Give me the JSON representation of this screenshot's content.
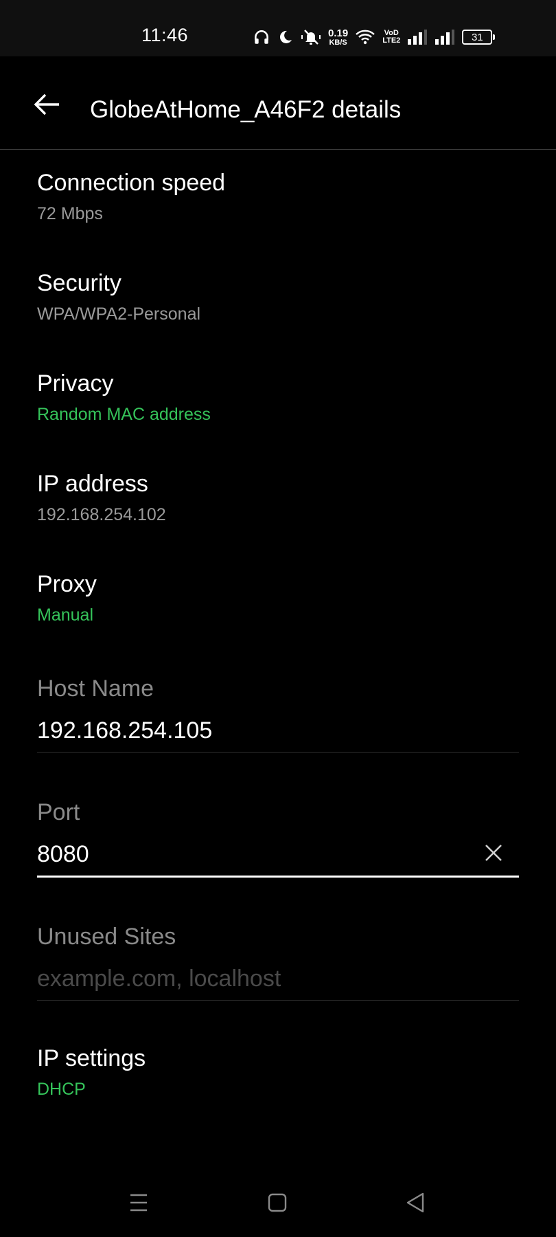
{
  "status_bar": {
    "time": "11:46",
    "net_speed_value": "0.19",
    "net_speed_unit": "KB/S",
    "volte_top": "VoD",
    "volte_bottom": "LTE2",
    "battery_level": "31"
  },
  "header": {
    "title": "GlobeAtHome_A46F2 details"
  },
  "details": {
    "connection_speed": {
      "title": "Connection speed",
      "value": "72 Mbps"
    },
    "security": {
      "title": "Security",
      "value": "WPA/WPA2-Personal"
    },
    "privacy": {
      "title": "Privacy",
      "value": "Random MAC address"
    },
    "ip_address": {
      "title": "IP address",
      "value": "192.168.254.102"
    },
    "proxy": {
      "title": "Proxy",
      "value": "Manual"
    },
    "ip_settings": {
      "title": "IP settings",
      "value": "DHCP"
    }
  },
  "proxy_fields": {
    "host_name": {
      "label": "Host Name",
      "value": "192.168.254.105",
      "placeholder": ""
    },
    "port": {
      "label": "Port",
      "value": "8080",
      "placeholder": ""
    },
    "unused_sites": {
      "label": "Unused Sites",
      "value": "",
      "placeholder": "example.com, localhost"
    }
  },
  "colors": {
    "background": "#000000",
    "accent": "#35c35a",
    "secondary_text": "#9a9a9a"
  },
  "icons": {
    "back": "arrow-left-icon",
    "clear": "close-icon",
    "nav_menu": "menu-lines-icon",
    "nav_home": "square-icon",
    "nav_back": "triangle-back-icon"
  }
}
